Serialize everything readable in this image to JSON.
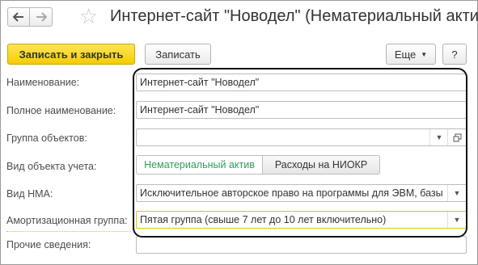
{
  "header": {
    "title": "Интернет-сайт \"Новодел\" (Нематериальный актив)",
    "back_icon": "arrow-left",
    "forward_icon": "arrow-right",
    "favorite_icon": "star"
  },
  "toolbar": {
    "save_close_label": "Записать и закрыть",
    "save_label": "Записать",
    "more_label": "Еще",
    "help_label": "?"
  },
  "form": {
    "name": {
      "label": "Наименование:",
      "value": "Интернет-сайт \"Новодел\""
    },
    "full_name": {
      "label": "Полное наименование:",
      "value": "Интернет-сайт \"Новодел\""
    },
    "object_group": {
      "label": "Группа объектов:",
      "value": ""
    },
    "accounting_object_type": {
      "label": "Вид объекта учета:",
      "options": [
        "Нематериальный актив",
        "Расходы на НИОКР"
      ],
      "selected": "Нематериальный актив"
    },
    "nma_type": {
      "label": "Вид НМА:",
      "value": "Исключительное авторское право на программы для ЭВМ, базы"
    },
    "depreciation_group": {
      "label": "Амортизационная группа:",
      "value": "Пятая группа (свыше 7 лет до 10 лет включительно)"
    },
    "other_info": {
      "label": "Прочие сведения:",
      "value": ""
    }
  },
  "colors": {
    "primary_button": "#f5cc00",
    "active_segment_text": "#2e9e5b",
    "focus_underline": "#f0c000",
    "highlight_border": "#111111"
  }
}
